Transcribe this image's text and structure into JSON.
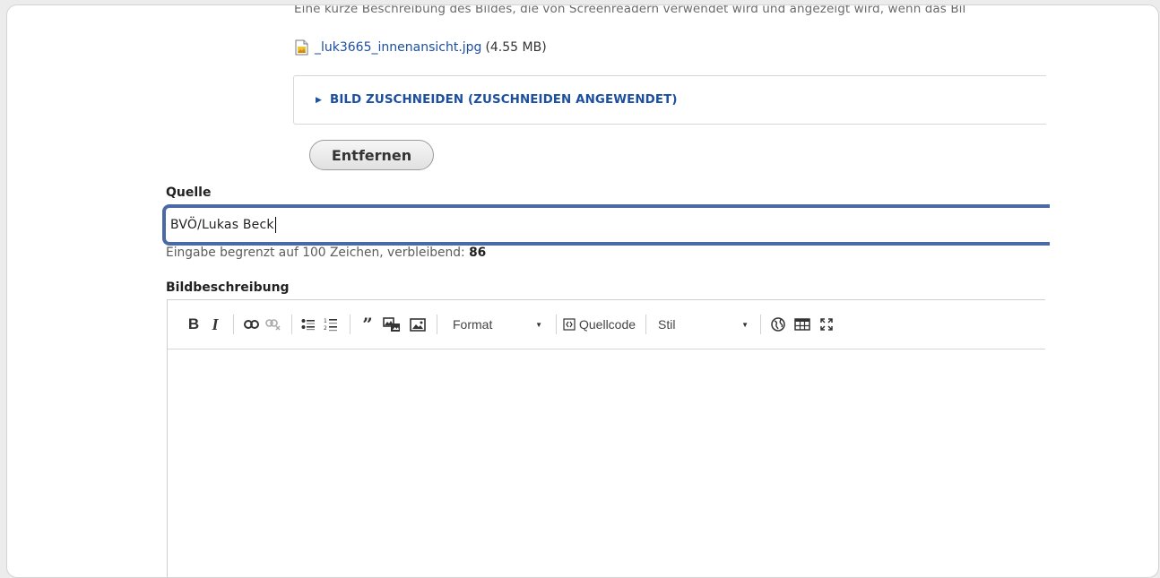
{
  "description_hint": "Eine kurze Beschreibung des Bildes, die von Screenreadern verwendet wird und angezeigt wird, wenn das Bil",
  "file": {
    "name": "_luk3665_innenansicht.jpg",
    "size": "(4.55 MB)"
  },
  "crop_details": {
    "summary": "BILD ZUSCHNEIDEN (ZUSCHNEIDEN ANGEWENDET)"
  },
  "remove_button": "Entfernen",
  "source_field": {
    "label": "Quelle",
    "value": "BVÖ/Lukas Beck",
    "help_prefix": "Eingabe begrenzt auf 100 Zeichen, verbleibend:",
    "remaining": "86"
  },
  "description_field": {
    "label": "Bildbeschreibung"
  },
  "toolbar": {
    "bold": "B",
    "italic": "I",
    "format_label": "Format",
    "source_label": "Quellcode",
    "style_label": "Stil"
  },
  "colors": {
    "link": "#1c4fa0",
    "focus_border": "#4b6aa5"
  }
}
